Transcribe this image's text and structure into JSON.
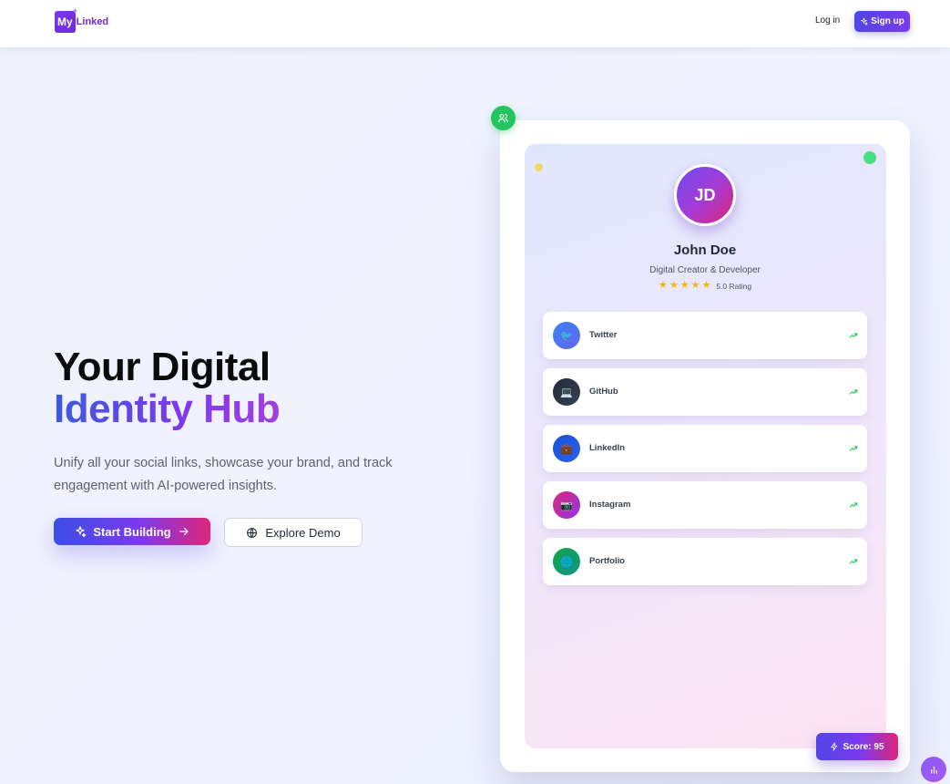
{
  "header": {
    "logo_my": "My",
    "logo_linked": "Linked",
    "login_label": "Log in",
    "signup_label": "Sign up"
  },
  "hero": {
    "title_line1": "Your Digital",
    "title_line2": "Identity Hub",
    "subtitle": "Unify all your social links, showcase your brand, and track engagement with AI-powered insights.",
    "start_label": "Start Building",
    "demo_label": "Explore Demo"
  },
  "profile": {
    "initials": "JD",
    "name": "John Doe",
    "role": "Digital Creator & Developer",
    "rating_stars": 5,
    "rating_label": "5.0 Rating"
  },
  "links": [
    {
      "label": "Twitter",
      "icon": "bird-icon",
      "glyph": "🐦",
      "color_from": "#3b82f6",
      "color_to": "#6366f1"
    },
    {
      "label": "GitHub",
      "icon": "laptop-icon",
      "glyph": "💻",
      "color_from": "#1f2937",
      "color_to": "#374151"
    },
    {
      "label": "LinkedIn",
      "icon": "briefcase-icon",
      "glyph": "💼",
      "color_from": "#1d4ed8",
      "color_to": "#2563eb"
    },
    {
      "label": "Instagram",
      "icon": "camera-icon",
      "glyph": "📷",
      "color_from": "#db2777",
      "color_to": "#9333ea"
    },
    {
      "label": "Portfolio",
      "icon": "globe-icon",
      "glyph": "🌐",
      "color_from": "#16a34a",
      "color_to": "#0d9488"
    }
  ],
  "score": {
    "label": "Score: 95"
  },
  "colors": {
    "accent": "#7c3aed",
    "accent_blue": "#4f46e5",
    "accent_pink": "#db2777",
    "success": "#22c55e"
  }
}
